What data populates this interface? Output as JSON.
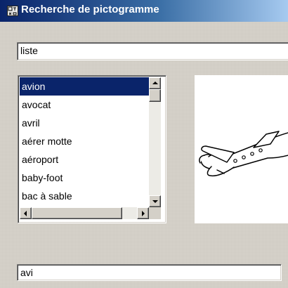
{
  "window": {
    "title": "Recherche de pictogramme",
    "icon": "pictogram-app-icon"
  },
  "search": {
    "value": "liste"
  },
  "list": {
    "items": [
      "avion",
      "avocat",
      "avril",
      "aérer motte",
      "aéroport",
      "baby-foot",
      "bac à sable"
    ],
    "selected_index": 0,
    "selected_bg": "#0a246a",
    "selected_fg": "#ffffff"
  },
  "preview": {
    "icon": "airplane-pictogram-icon"
  },
  "bottom_input": {
    "value": "avi"
  },
  "colors": {
    "titlebar_start": "#0a246a",
    "titlebar_end": "#a6caf0",
    "window_bg": "#d4d0c8"
  }
}
